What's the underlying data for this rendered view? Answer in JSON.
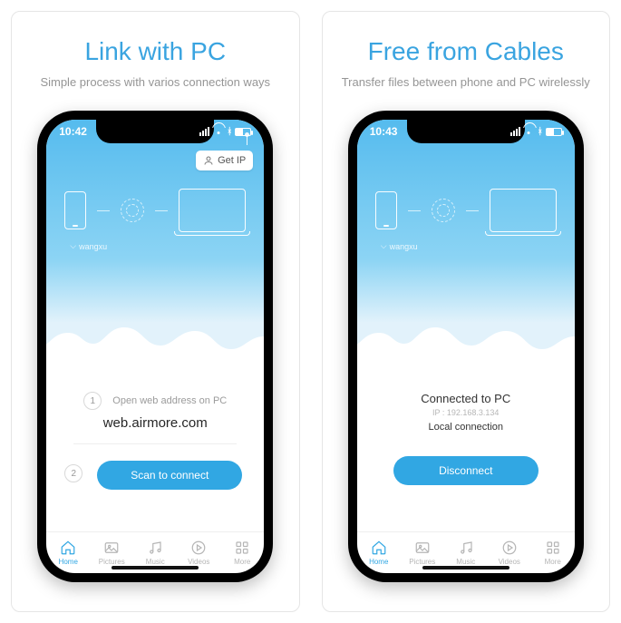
{
  "left": {
    "title": "Link with PC",
    "subtitle": "Simple process with varios connection ways",
    "status_time": "10:42",
    "getip_label": "Get IP",
    "wifi_name": "wangxu",
    "step1_num": "1",
    "step1_text": "Open web address on PC",
    "address": "web.airmore.com",
    "step2_num": "2",
    "scan_button": "Scan to connect"
  },
  "right": {
    "title": "Free from Cables",
    "subtitle": "Transfer files between phone and PC wirelessly",
    "status_time": "10:43",
    "wifi_name": "wangxu",
    "connected_heading": "Connected to PC",
    "connected_ip": "IP : 192.168.3.134",
    "local_connection": "Local connection",
    "disconnect_button": "Disconnect"
  },
  "tabs": {
    "home": "Home",
    "pictures": "Pictures",
    "music": "Music",
    "videos": "Videos",
    "more": "More"
  }
}
